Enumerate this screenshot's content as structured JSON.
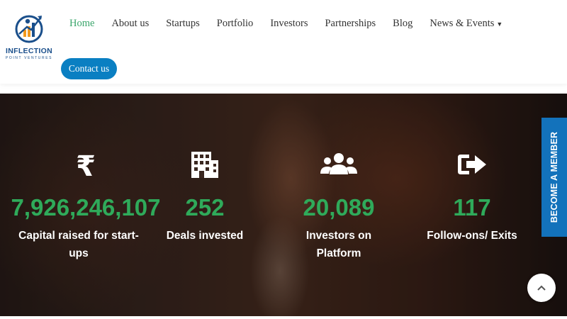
{
  "brand": {
    "name": "INFLECTION",
    "sub": "POINT VENTURES"
  },
  "nav": {
    "items": [
      {
        "label": "Home",
        "active": true
      },
      {
        "label": "About us"
      },
      {
        "label": "Startups"
      },
      {
        "label": "Portfolio"
      },
      {
        "label": "Investors"
      },
      {
        "label": "Partnerships"
      },
      {
        "label": "Blog"
      },
      {
        "label": "News & Events",
        "has_dropdown": true
      }
    ],
    "contact_label": "Contact us"
  },
  "stats": [
    {
      "icon": "rupee-icon",
      "value": "7,926,246,107",
      "label": "Capital raised for start-ups"
    },
    {
      "icon": "building-icon",
      "value": "252",
      "label": "Deals invested"
    },
    {
      "icon": "users-icon",
      "value": "20,089",
      "label": "Investors on Platform"
    },
    {
      "icon": "exit-arrow-icon",
      "value": "117",
      "label": "Follow-ons/ Exits"
    }
  ],
  "side_tab": {
    "label": "BECOME A MEMBER"
  },
  "colors": {
    "accent_green": "#2faa5a",
    "nav_active": "#3aa56b",
    "button_blue": "#0a7fc2",
    "side_tab_blue": "#1372bb"
  },
  "icons": {
    "scroll_top": "chevron-up-icon"
  }
}
